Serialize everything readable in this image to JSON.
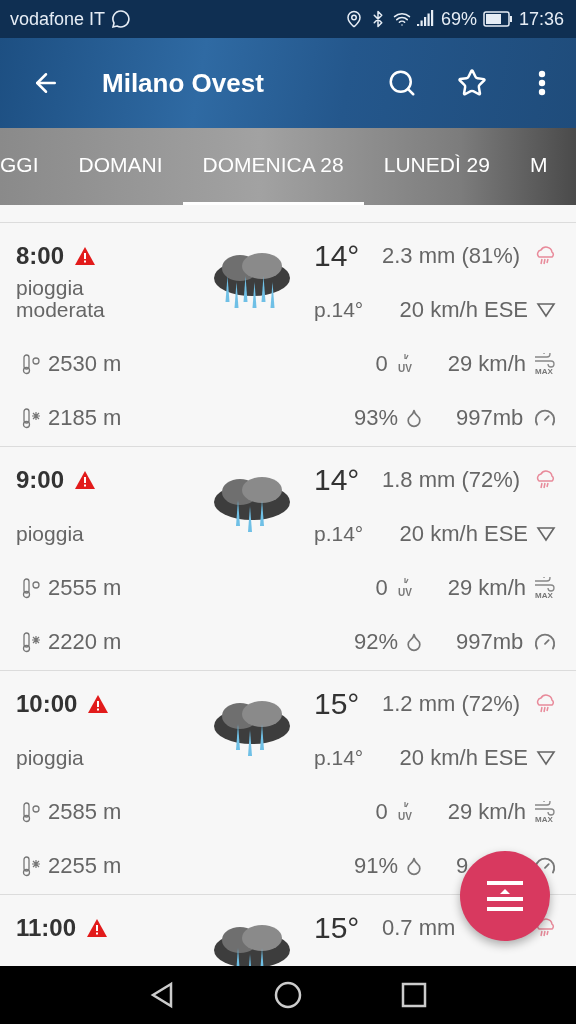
{
  "status_bar": {
    "carrier": "vodafone IT",
    "battery": "69%",
    "time": "17:36"
  },
  "app_bar": {
    "title": "Milano Ovest"
  },
  "tabs": [
    {
      "label": "GGI",
      "selected": false
    },
    {
      "label": "DOMANI",
      "selected": false
    },
    {
      "label": "DOMENICA 28",
      "selected": true
    },
    {
      "label": "LUNEDÌ 29",
      "selected": false
    },
    {
      "label": "M",
      "selected": false
    }
  ],
  "hours": [
    {
      "time": "8:00",
      "alert": true,
      "description": "pioggia moderata",
      "kind": "downpour",
      "temperature": "14°",
      "perceived": "p.14°",
      "rain": "2.3 mm (81%)",
      "wind": "20 km/h ESE",
      "freezing_level": "2530 m",
      "uv": "0",
      "uv_unit": "UV",
      "gust": "29 km/h",
      "gust_unit": "MAX",
      "snow_level": "2185 m",
      "humidity": "93%",
      "pressure": "997mb"
    },
    {
      "time": "9:00",
      "alert": true,
      "description": "pioggia",
      "kind": "rain",
      "temperature": "14°",
      "perceived": "p.14°",
      "rain": "1.8 mm (72%)",
      "wind": "20 km/h ESE",
      "freezing_level": "2555 m",
      "uv": "0",
      "uv_unit": "UV",
      "gust": "29 km/h",
      "gust_unit": "MAX",
      "snow_level": "2220 m",
      "humidity": "92%",
      "pressure": "997mb"
    },
    {
      "time": "10:00",
      "alert": true,
      "description": "pioggia",
      "kind": "rain",
      "temperature": "15°",
      "perceived": "p.14°",
      "rain": "1.2 mm (72%)",
      "wind": "20 km/h ESE",
      "freezing_level": "2585 m",
      "uv": "0",
      "uv_unit": "UV",
      "gust": "29 km/h",
      "gust_unit": "MAX",
      "snow_level": "2255 m",
      "humidity": "91%",
      "pressure": "9"
    },
    {
      "time": "11:00",
      "alert": true,
      "kind": "rain",
      "temperature": "15°",
      "rain": "0.7 mm"
    }
  ]
}
